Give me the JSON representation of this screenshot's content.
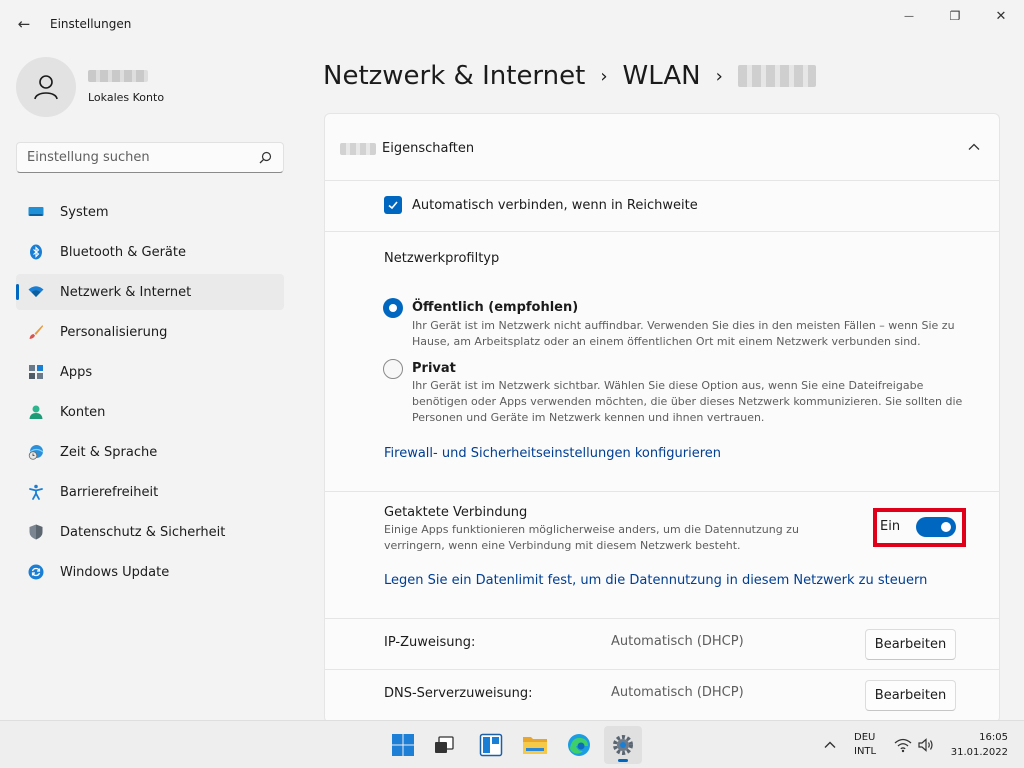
{
  "window": {
    "title": "Einstellungen",
    "back_glyph": "←",
    "minimize_glyph": "—",
    "maximize_glyph": "❐",
    "close_glyph": "✕"
  },
  "user": {
    "account_type": "Lokales Konto"
  },
  "search": {
    "placeholder": "Einstellung suchen"
  },
  "sidebar": {
    "items": [
      {
        "label": "System",
        "icon": "system-icon",
        "selected": false
      },
      {
        "label": "Bluetooth & Geräte",
        "icon": "bluetooth-icon",
        "selected": false
      },
      {
        "label": "Netzwerk & Internet",
        "icon": "wifi-icon",
        "selected": true
      },
      {
        "label": "Personalisierung",
        "icon": "brush-icon",
        "selected": false
      },
      {
        "label": "Apps",
        "icon": "apps-icon",
        "selected": false
      },
      {
        "label": "Konten",
        "icon": "account-icon",
        "selected": false
      },
      {
        "label": "Zeit & Sprache",
        "icon": "time-language-icon",
        "selected": false
      },
      {
        "label": "Barrierefreiheit",
        "icon": "accessibility-icon",
        "selected": false
      },
      {
        "label": "Datenschutz & Sicherheit",
        "icon": "shield-icon",
        "selected": false
      },
      {
        "label": "Windows Update",
        "icon": "update-icon",
        "selected": false
      }
    ]
  },
  "breadcrumb": {
    "level1": "Netzwerk & Internet",
    "level2": "WLAN",
    "separator": "›"
  },
  "card": {
    "title": "Eigenschaften",
    "auto_connect_label": "Automatisch verbinden, wenn in Reichweite",
    "profile_type_title": "Netzwerkprofiltyp",
    "public_title": "Öffentlich (empfohlen)",
    "public_desc": "Ihr Gerät ist im Netzwerk nicht auffindbar. Verwenden Sie dies in den meisten Fällen – wenn Sie zu Hause, am Arbeitsplatz oder an einem öffentlichen Ort mit einem Netzwerk verbunden sind.",
    "private_title": "Privat",
    "private_desc": "Ihr Gerät ist im Netzwerk sichtbar. Wählen Sie diese Option aus, wenn Sie eine Dateifreigabe benötigen oder Apps verwenden möchten, die über dieses Netzwerk kommunizieren. Sie sollten die Personen und Geräte im Netzwerk kennen und ihnen vertrauen.",
    "firewall_link": "Firewall- und Sicherheitseinstellungen konfigurieren",
    "metered_title": "Getaktete Verbindung",
    "metered_desc": "Einige Apps funktionieren möglicherweise anders, um die Datennutzung zu verringern, wenn eine Verbindung mit diesem Netzwerk besteht.",
    "metered_state": "Ein",
    "data_limit_link": "Legen Sie ein Datenlimit fest, um die Datennutzung in diesem Netzwerk zu steuern",
    "ip_label": "IP-Zuweisung:",
    "ip_value": "Automatisch (DHCP)",
    "dns_label": "DNS-Serverzuweisung:",
    "dns_value": "Automatisch (DHCP)",
    "edit_label": "Bearbeiten"
  },
  "taskbar": {
    "apps": [
      "start-icon",
      "task-view-icon",
      "widgets-icon",
      "file-explorer-icon",
      "edge-icon",
      "settings-icon"
    ],
    "lang_line1": "DEU",
    "lang_line2": "INTL",
    "time": "16:05",
    "date": "31.01.2022"
  },
  "colors": {
    "accent": "#0067c0",
    "link": "#003e92",
    "highlight": "#e0001a"
  }
}
